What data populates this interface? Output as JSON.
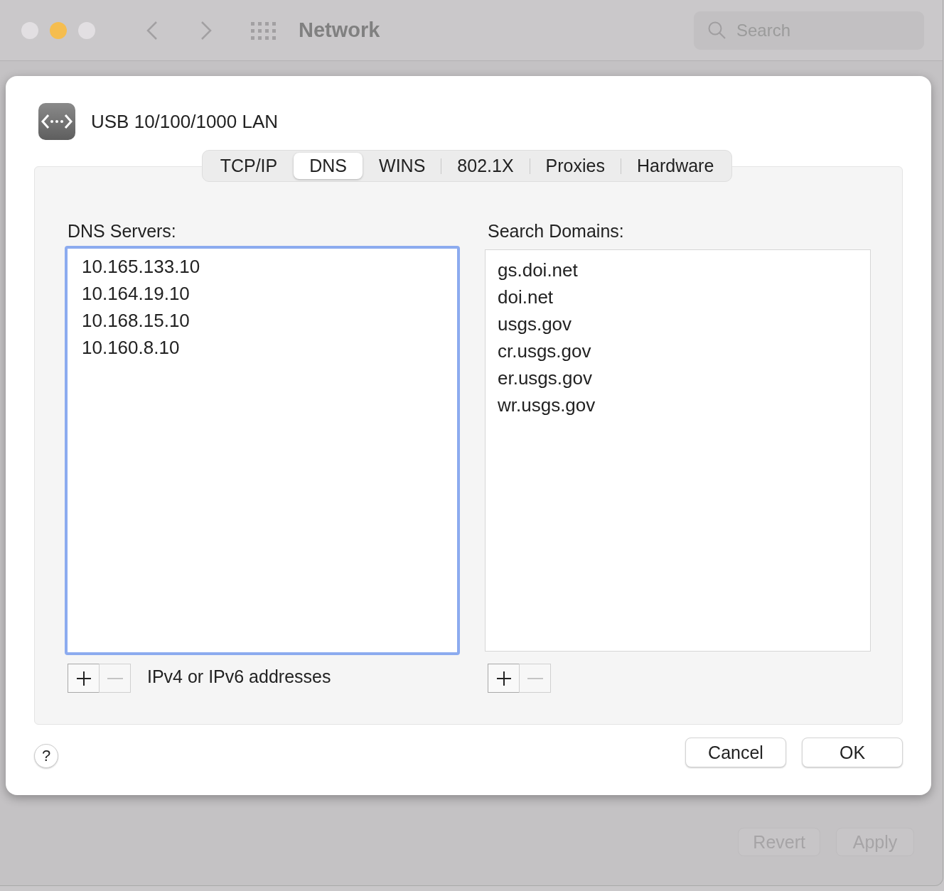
{
  "window": {
    "title": "Network",
    "search": {
      "placeholder": "Search"
    }
  },
  "sheet": {
    "interface_name": "USB 10/100/1000 LAN",
    "tabs": [
      {
        "label": "TCP/IP",
        "selected": false
      },
      {
        "label": "DNS",
        "selected": true
      },
      {
        "label": "WINS",
        "selected": false
      },
      {
        "label": "802.1X",
        "selected": false
      },
      {
        "label": "Proxies",
        "selected": false
      },
      {
        "label": "Hardware",
        "selected": false
      }
    ],
    "dns_servers": {
      "label": "DNS Servers:",
      "focused": true,
      "items": [
        "10.165.133.10",
        "10.164.19.10",
        "10.168.15.10",
        "10.160.8.10"
      ],
      "add_disabled": false,
      "remove_disabled": true,
      "hint": "IPv4 or IPv6 addresses"
    },
    "search_domains": {
      "label": "Search Domains:",
      "focused": false,
      "items": [
        "gs.doi.net",
        "doi.net",
        "usgs.gov",
        "cr.usgs.gov",
        "er.usgs.gov",
        "wr.usgs.gov"
      ],
      "add_disabled": false,
      "remove_disabled": true
    },
    "help": "?",
    "buttons": [
      {
        "label": "Cancel"
      },
      {
        "label": "OK"
      }
    ]
  },
  "footer_buttons": [
    {
      "label": "Revert",
      "disabled": true
    },
    {
      "label": "Apply",
      "disabled": true
    }
  ]
}
